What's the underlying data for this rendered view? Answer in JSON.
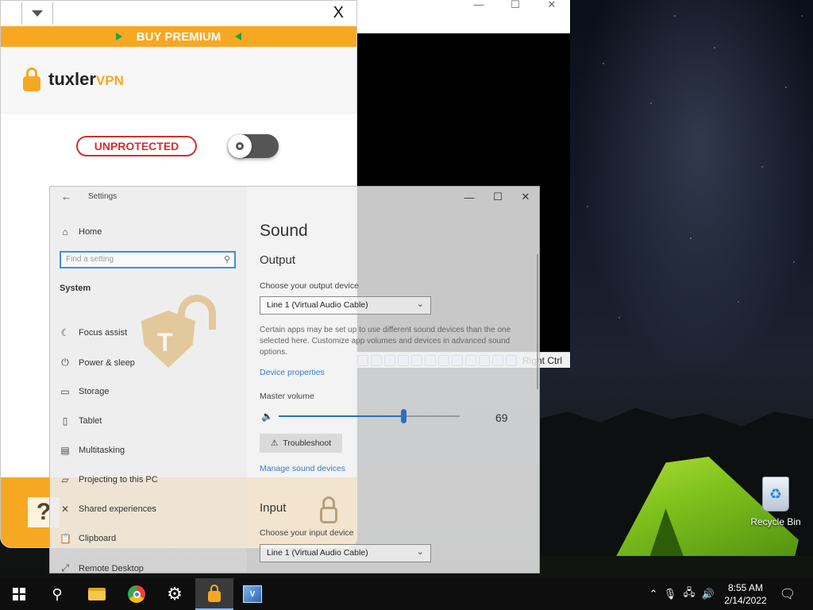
{
  "tuxler": {
    "premium_label": "BUY PREMIUM",
    "brand_main": "tuxler",
    "brand_accent": "VPN",
    "close_label": "X",
    "status_label": "UNPROTECTED",
    "help_label": "?",
    "accent_color": "#f7a823",
    "status_color": "#d0302f",
    "toggle_on": false
  },
  "settings": {
    "window_title": "Settings",
    "search_placeholder": "Find a setting",
    "nav_home": "Home",
    "section_label": "System",
    "nav_items": [
      {
        "label": "Focus assist",
        "icon": "moon-icon"
      },
      {
        "label": "Power & sleep",
        "icon": "power-icon"
      },
      {
        "label": "Storage",
        "icon": "storage-icon"
      },
      {
        "label": "Tablet",
        "icon": "tablet-icon"
      },
      {
        "label": "Multitasking",
        "icon": "multitasking-icon"
      },
      {
        "label": "Projecting to this PC",
        "icon": "projecting-icon"
      },
      {
        "label": "Shared experiences",
        "icon": "shared-icon"
      },
      {
        "label": "Clipboard",
        "icon": "clipboard-icon"
      },
      {
        "label": "Remote Desktop",
        "icon": "remote-desktop-icon"
      }
    ],
    "page_title": "Sound",
    "output": {
      "heading": "Output",
      "device_label": "Choose your output device",
      "device_value": "Line 1 (Virtual Audio Cable)",
      "note": "Certain apps may be set up to use different sound devices than the one selected here. Customize app volumes and devices in advanced sound options.",
      "properties_link": "Device properties",
      "master_volume_label": "Master volume",
      "volume": 69,
      "troubleshoot_label": "Troubleshoot",
      "manage_link": "Manage sound devices"
    },
    "input": {
      "heading": "Input",
      "device_label": "Choose your input device",
      "device_value": "Line 1 (Virtual Audio Cable)"
    }
  },
  "vbox": {
    "host_key": "Right Ctrl"
  },
  "desktop": {
    "recycle_bin_label": "Recycle Bin"
  },
  "taskbar": {
    "time": "8:55 AM",
    "date": "2/14/2022"
  }
}
